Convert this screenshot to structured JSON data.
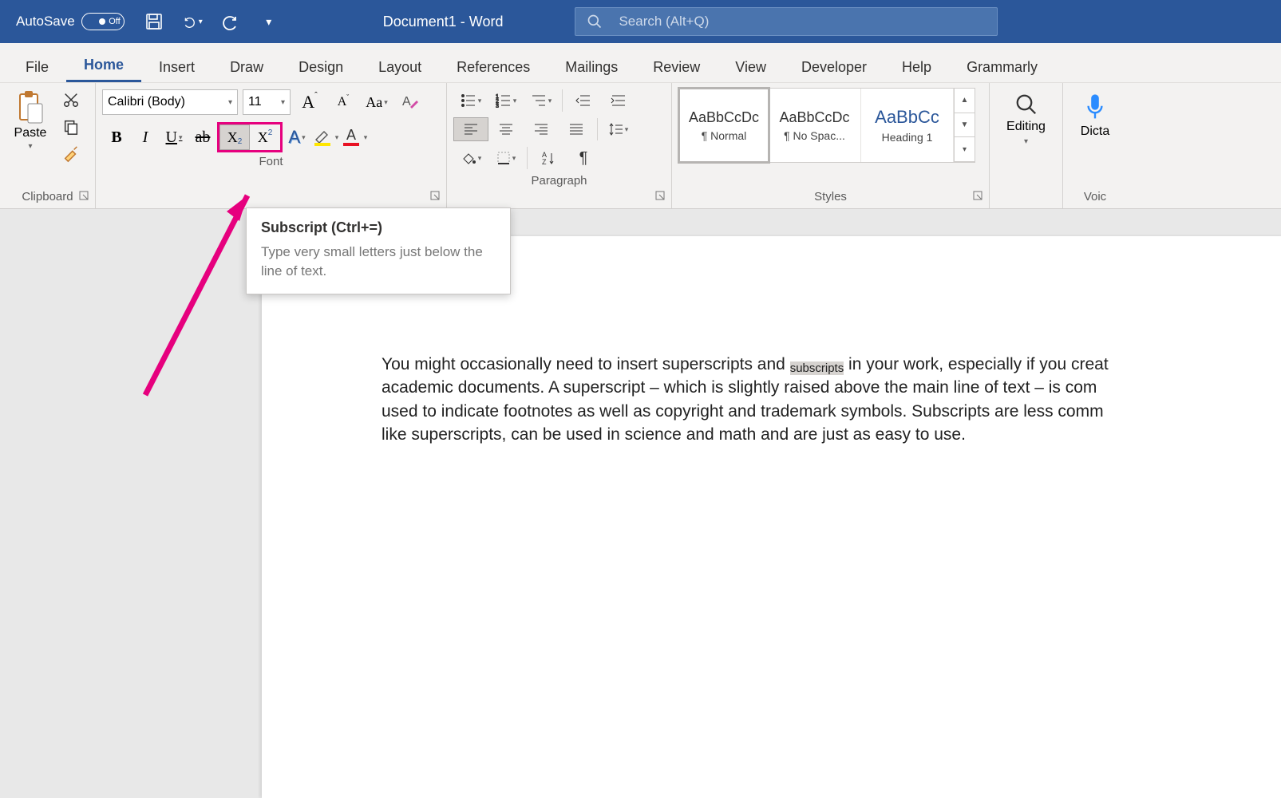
{
  "titlebar": {
    "autosave_label": "AutoSave",
    "autosave_state": "Off",
    "doc_title": "Document1  -  Word",
    "search_placeholder": "Search (Alt+Q)"
  },
  "tabs": [
    "File",
    "Home",
    "Insert",
    "Draw",
    "Design",
    "Layout",
    "References",
    "Mailings",
    "Review",
    "View",
    "Developer",
    "Help",
    "Grammarly"
  ],
  "active_tab": "Home",
  "ribbon": {
    "clipboard": {
      "label": "Clipboard",
      "paste": "Paste"
    },
    "font": {
      "label": "Font",
      "name": "Calibri (Body)",
      "size": "11"
    },
    "paragraph": {
      "label": "Paragraph"
    },
    "styles": {
      "label": "Styles",
      "items": [
        {
          "preview": "AaBbCcDc",
          "name": "¶ Normal"
        },
        {
          "preview": "AaBbCcDc",
          "name": "¶ No Spac..."
        },
        {
          "preview": "AaBbCc",
          "name": "Heading 1"
        }
      ]
    },
    "editing": {
      "label": "Editing"
    },
    "voice": {
      "label": "Voic",
      "dictate": "Dicta"
    }
  },
  "tooltip": {
    "title": "Subscript (Ctrl+=)",
    "body": "Type very small letters just below the line of text."
  },
  "document": {
    "line1a": "You might occasionally need to insert superscripts and ",
    "line1_sel": "subscripts",
    "line1b": " in your work, especially if you creat",
    "line2": "academic documents. A superscript – which is slightly raised above the main line of text – is com",
    "line3": "used to indicate footnotes as well as copyright and trademark symbols. Subscripts are less comm",
    "line4": "like superscripts, can be used in science and math and are just as easy to use."
  }
}
